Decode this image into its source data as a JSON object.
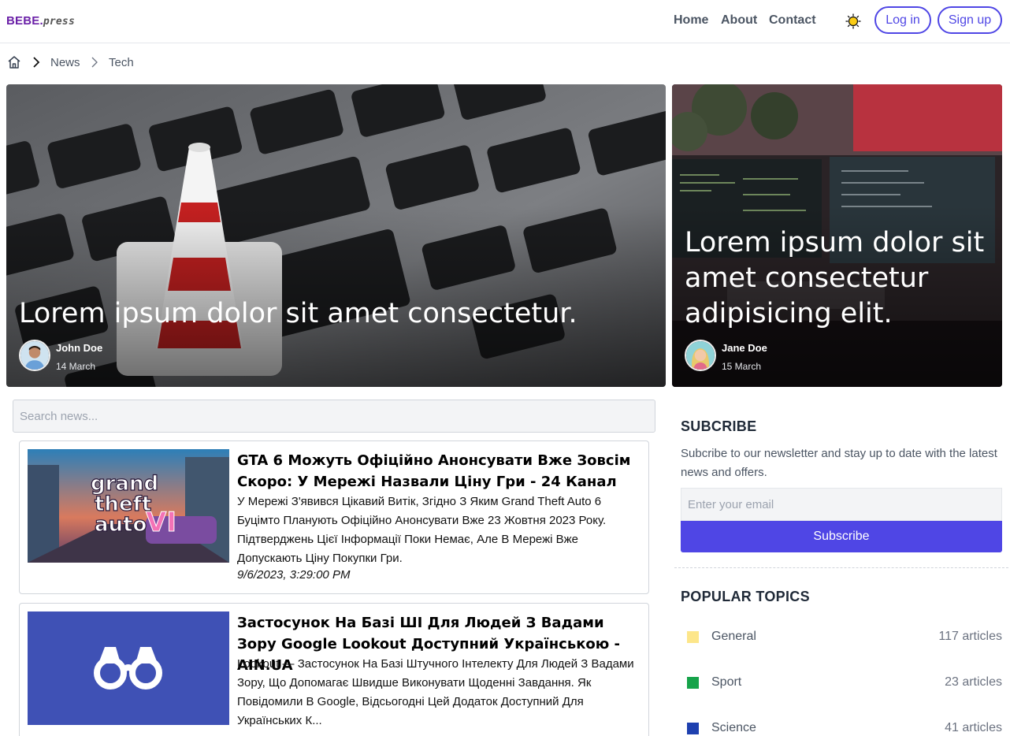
{
  "header": {
    "logo_main": "BEBE.",
    "logo_suffix": "press",
    "nav": {
      "home": "Home",
      "about": "About",
      "contact": "Contact"
    },
    "login": "Log in",
    "signup": "Sign up",
    "theme_icon": "sun-icon"
  },
  "breadcrumb": {
    "home_icon": "home-icon",
    "items": [
      "News",
      "Tech"
    ]
  },
  "hero": [
    {
      "title": "Lorem ipsum dolor sit amet consectetur.",
      "author": "John Doe",
      "date": "14 March"
    },
    {
      "title": "Lorem ipsum dolor sit amet consectetur adipisicing elit.",
      "author": "Jane Doe",
      "date": "15 March"
    }
  ],
  "search": {
    "placeholder": "Search news..."
  },
  "news": [
    {
      "title": "GTA 6 Можуть Офіційно Анонсувати Вже Зовсім Скоро: У Мережі Назвали Ціну Гри - 24 Канал",
      "description": "У Мережі З'явився Цікавий Витік, Згідно З Яким Grand Theft Auto 6 Буцімто Планують Офіційно Анонсувати Вже 23 Жовтня 2023 Року. Підтверджень Цієї Інформації Поки Немає, Але В Мережі Вже Допускають Ціну Покупки Гри.",
      "date": "9/6/2023, 3:29:00 PM",
      "thumb_text": [
        "grand",
        "theft",
        "auto",
        "VI"
      ]
    },
    {
      "title": "Застосунок На Базі ШІ Для Людей З Вадами Зору Google Lookout Доступний Українською - AIN.UA",
      "description": "Lookout — Застосунок На Базі Штучного Інтелекту Для Людей З Вадами Зору, Що Допомагає Швидше Виконувати Щоденні Завдання. Як Повідомили В Google, Відсьогодні Цей Додаток Доступний Для Українських К...",
      "thumb_icon": "binoculars-icon"
    }
  ],
  "sidebar": {
    "subscribe_title": "SUBCRIBE",
    "subscribe_text": "Subcribe to our newsletter and stay up to date with the latest news and offers.",
    "email_placeholder": "Enter your email",
    "subscribe_button": "Subscribe",
    "popular_title": "POPULAR TOPICS",
    "topics": [
      {
        "name": "General",
        "count": "117 articles",
        "color": "#fde68a"
      },
      {
        "name": "Sport",
        "count": "23 articles",
        "color": "#16a34a"
      },
      {
        "name": "Science",
        "count": "41 articles",
        "color": "#1e40af"
      }
    ]
  },
  "colors": {
    "accent": "#4f46e5",
    "logo": "#6b21a8"
  }
}
